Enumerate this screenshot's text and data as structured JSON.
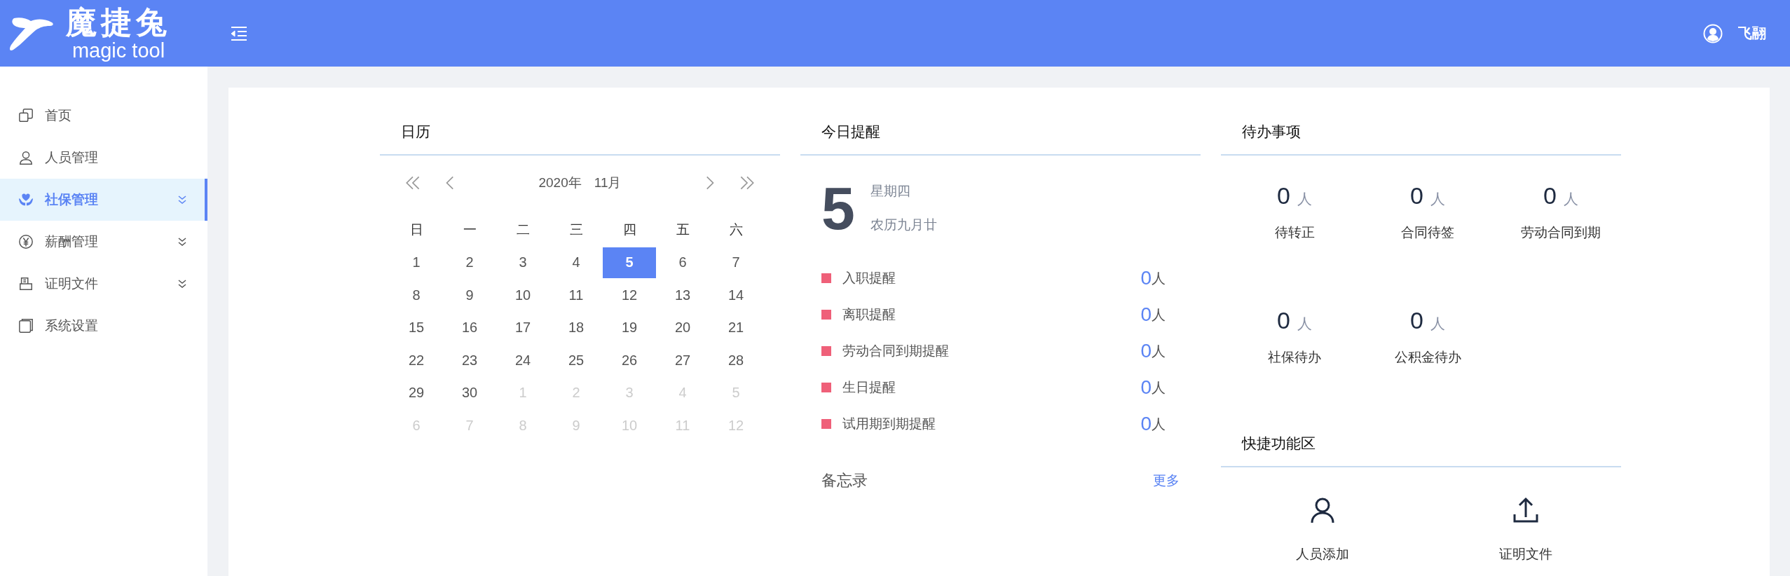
{
  "header": {
    "logo_title": "魔捷兔",
    "logo_subtitle": "magic tool",
    "user_name": "飞翮"
  },
  "sidebar": {
    "items": [
      {
        "label": "首页",
        "expandable": false,
        "selected": false
      },
      {
        "label": "人员管理",
        "expandable": false,
        "selected": false
      },
      {
        "label": "社保管理",
        "expandable": true,
        "selected": true
      },
      {
        "label": "薪酬管理",
        "expandable": true,
        "selected": false
      },
      {
        "label": "证明文件",
        "expandable": true,
        "selected": false
      },
      {
        "label": "系统设置",
        "expandable": false,
        "selected": false
      }
    ]
  },
  "calendar": {
    "title": "日历",
    "year_label": "2020年",
    "month_label": "11月",
    "weekdays": [
      "日",
      "一",
      "二",
      "三",
      "四",
      "五",
      "六"
    ],
    "days": [
      {
        "label": "1",
        "in_month": true,
        "selected": false
      },
      {
        "label": "2",
        "in_month": true,
        "selected": false
      },
      {
        "label": "3",
        "in_month": true,
        "selected": false
      },
      {
        "label": "4",
        "in_month": true,
        "selected": false
      },
      {
        "label": "5",
        "in_month": true,
        "selected": true
      },
      {
        "label": "6",
        "in_month": true,
        "selected": false
      },
      {
        "label": "7",
        "in_month": true,
        "selected": false
      },
      {
        "label": "8",
        "in_month": true,
        "selected": false
      },
      {
        "label": "9",
        "in_month": true,
        "selected": false
      },
      {
        "label": "10",
        "in_month": true,
        "selected": false
      },
      {
        "label": "11",
        "in_month": true,
        "selected": false
      },
      {
        "label": "12",
        "in_month": true,
        "selected": false
      },
      {
        "label": "13",
        "in_month": true,
        "selected": false
      },
      {
        "label": "14",
        "in_month": true,
        "selected": false
      },
      {
        "label": "15",
        "in_month": true,
        "selected": false
      },
      {
        "label": "16",
        "in_month": true,
        "selected": false
      },
      {
        "label": "17",
        "in_month": true,
        "selected": false
      },
      {
        "label": "18",
        "in_month": true,
        "selected": false
      },
      {
        "label": "19",
        "in_month": true,
        "selected": false
      },
      {
        "label": "20",
        "in_month": true,
        "selected": false
      },
      {
        "label": "21",
        "in_month": true,
        "selected": false
      },
      {
        "label": "22",
        "in_month": true,
        "selected": false
      },
      {
        "label": "23",
        "in_month": true,
        "selected": false
      },
      {
        "label": "24",
        "in_month": true,
        "selected": false
      },
      {
        "label": "25",
        "in_month": true,
        "selected": false
      },
      {
        "label": "26",
        "in_month": true,
        "selected": false
      },
      {
        "label": "27",
        "in_month": true,
        "selected": false
      },
      {
        "label": "28",
        "in_month": true,
        "selected": false
      },
      {
        "label": "29",
        "in_month": true,
        "selected": false
      },
      {
        "label": "30",
        "in_month": true,
        "selected": false
      },
      {
        "label": "1",
        "in_month": false,
        "selected": false
      },
      {
        "label": "2",
        "in_month": false,
        "selected": false
      },
      {
        "label": "3",
        "in_month": false,
        "selected": false
      },
      {
        "label": "4",
        "in_month": false,
        "selected": false
      },
      {
        "label": "5",
        "in_month": false,
        "selected": false
      },
      {
        "label": "6",
        "in_month": false,
        "selected": false
      },
      {
        "label": "7",
        "in_month": false,
        "selected": false
      },
      {
        "label": "8",
        "in_month": false,
        "selected": false
      },
      {
        "label": "9",
        "in_month": false,
        "selected": false
      },
      {
        "label": "10",
        "in_month": false,
        "selected": false
      },
      {
        "label": "11",
        "in_month": false,
        "selected": false
      },
      {
        "label": "12",
        "in_month": false,
        "selected": false
      }
    ]
  },
  "today": {
    "title": "今日提醒",
    "day": "5",
    "weekday": "星期四",
    "lunar_date": "农历九月廿",
    "reminders": [
      {
        "label": "入职提醒",
        "count": "0",
        "unit": "人"
      },
      {
        "label": "离职提醒",
        "count": "0",
        "unit": "人"
      },
      {
        "label": "劳动合同到期提醒",
        "count": "0",
        "unit": "人"
      },
      {
        "label": "生日提醒",
        "count": "0",
        "unit": "人"
      },
      {
        "label": "试用期到期提醒",
        "count": "0",
        "unit": "人"
      }
    ],
    "memo": {
      "label": "备忘录",
      "more": "更多"
    }
  },
  "todo": {
    "title": "待办事项",
    "items": [
      {
        "count": "0",
        "unit": "人",
        "label": "待转正"
      },
      {
        "count": "0",
        "unit": "人",
        "label": "合同待签"
      },
      {
        "count": "0",
        "unit": "人",
        "label": "劳动合同到期"
      },
      {
        "count": "0",
        "unit": "人",
        "label": "社保待办"
      },
      {
        "count": "0",
        "unit": "人",
        "label": "公积金待办"
      }
    ]
  },
  "quick": {
    "title": "快捷功能区",
    "actions": [
      {
        "label": "人员添加"
      },
      {
        "label": "证明文件"
      }
    ]
  }
}
